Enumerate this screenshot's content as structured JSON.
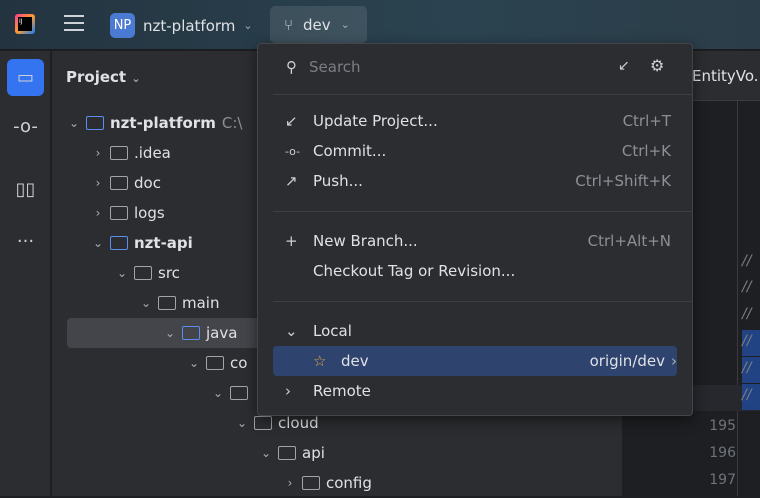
{
  "header": {
    "project_initials": "NP",
    "project_name": "nzt-platform",
    "branch": "dev"
  },
  "project_panel": {
    "title": "Project",
    "tree": [
      {
        "label": "nzt-platform",
        "extra": "C:\\"
      },
      {
        "label": ".idea"
      },
      {
        "label": "doc"
      },
      {
        "label": "logs"
      },
      {
        "label": "nzt-api"
      },
      {
        "label": "src"
      },
      {
        "label": "main"
      },
      {
        "label": "java"
      },
      {
        "label": "co"
      },
      {
        "label": ""
      },
      {
        "label": "cloud"
      },
      {
        "label": "api"
      },
      {
        "label": "config"
      }
    ]
  },
  "editor": {
    "tab": "EntityVo.",
    "line_numbers": [
      "195",
      "196",
      "197"
    ],
    "comment": "//"
  },
  "popup": {
    "search_placeholder": "Search",
    "actions": [
      {
        "label": "Update Project...",
        "shortcut": "Ctrl+T"
      },
      {
        "label": "Commit...",
        "shortcut": "Ctrl+K"
      },
      {
        "label": "Push...",
        "shortcut": "Ctrl+Shift+K"
      }
    ],
    "branch_actions": [
      {
        "label": "New Branch...",
        "shortcut": "Ctrl+Alt+N"
      },
      {
        "label": "Checkout Tag or Revision..."
      }
    ],
    "local_label": "Local",
    "local_branch": "dev",
    "local_tracking": "origin/dev",
    "remote_label": "Remote"
  }
}
